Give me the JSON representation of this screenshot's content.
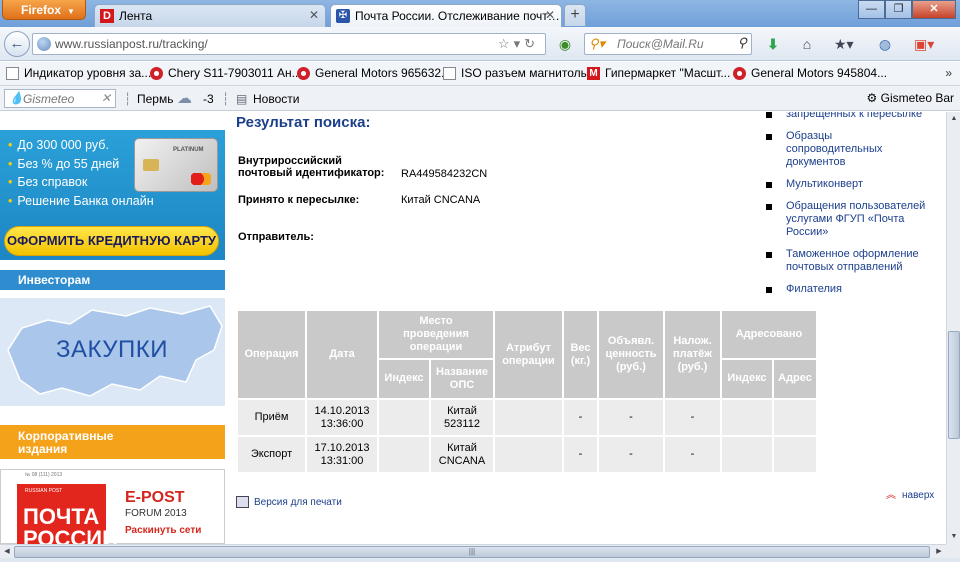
{
  "browser": {
    "menu_button": "Firefox",
    "tabs": [
      {
        "label": "Лента",
        "icon": "d-logo-icon"
      },
      {
        "label": "Почта России. Отслеживание почт…",
        "icon": "russian-post-eagle-icon"
      }
    ],
    "url": "www.russianpost.ru/tracking/",
    "search_placeholder": "Поиск@Mail.Ru"
  },
  "bookmarks": [
    {
      "label": "Индикатор уровня за...",
      "icon": "page-icon"
    },
    {
      "label": "Chery S11-7903011 Ан...",
      "icon": "red-wheel-icon"
    },
    {
      "label": "General Motors 965632...",
      "icon": "red-wheel-icon"
    },
    {
      "label": "ISO разъем магнитолы",
      "icon": "page-icon"
    },
    {
      "label": "Гипермаркет \"Масшт...",
      "icon": "m-logo-icon"
    },
    {
      "label": "General Motors 945804...",
      "icon": "red-wheel-icon"
    }
  ],
  "gismeteo": {
    "input_placeholder": "Gismeteo",
    "city": "Пермь",
    "temperature": "-3",
    "news": "Новости",
    "bar_name": "Gismeteo Bar"
  },
  "sidebar": {
    "credit_items": [
      "До 300 000 руб.",
      "Без % до 55 дней",
      "Без справок",
      "Решение Банка онлайн"
    ],
    "card_text": "PLATINUM",
    "credit_button": "ОФОРМИТЬ КРЕДИТНУЮ КАРТУ",
    "investors": "Инвесторам",
    "zakupki": "ЗАКУПКИ",
    "corporate_line1": "Корпоративные",
    "corporate_line2": "издания",
    "epost_title": "E-POST",
    "epost_subtitle": "FORUM 2013",
    "epost_tagline": "Раскинуть сети",
    "magazine_small": "RUSSIAN POST",
    "magazine_num": "№ 08 (111) 2013",
    "magazine_line1": "ПОЧТА",
    "magazine_line2": "РОССИИ"
  },
  "result": {
    "title": "Результат поиска:",
    "id_label_1": "Внутрироссийский",
    "id_label_2": "почтовый идентификатор:",
    "id_value": "RA449584232CN",
    "accepted_label": "Принято к пересылке:",
    "accepted_value": "Китай CNCANA",
    "sender_label": "Отправитель:"
  },
  "right_links": [
    {
      "line1": "запрещенных к пересылке",
      "line2": "",
      "line3": ""
    },
    {
      "line1": "Образцы",
      "line2": "сопроводительных",
      "line3": "документов"
    },
    {
      "line1": "Мультиконверт",
      "line2": "",
      "line3": ""
    },
    {
      "line1": "Обращения пользователей",
      "line2": "услугами ФГУП «Почта",
      "line3": "России»"
    },
    {
      "line1": "Таможенное оформление",
      "line2": "почтовых отправлений",
      "line3": ""
    },
    {
      "line1": "Филателия",
      "line2": "",
      "line3": ""
    }
  ],
  "table": {
    "headers": {
      "operation": "Операция",
      "date": "Дата",
      "place_1": "Место",
      "place_2": "проведения",
      "place_3": "операции",
      "attr_1": "Атрибут",
      "attr_2": "операции",
      "weight_1": "Вес",
      "weight_2": "(кг.)",
      "value_1": "Объявл.",
      "value_2": "ценность",
      "value_3": "(руб.)",
      "cod_1": "Налож.",
      "cod_2": "платёж",
      "cod_3": "(руб.)",
      "addressed": "Адресовано",
      "index": "Индекс",
      "ops_1": "Название",
      "ops_2": "ОПС",
      "addr_index": "Индекс",
      "addr": "Адрес"
    },
    "rows": [
      {
        "operation": "Приём",
        "date": "14.10.2013",
        "time": "13:36:00",
        "index": "",
        "ops_1": "Китай",
        "ops_2": "523112",
        "attr": "",
        "weight": "-",
        "value": "-",
        "cod": "-",
        "addr_index": "",
        "addr": ""
      },
      {
        "operation": "Экспорт",
        "date": "17.10.2013",
        "time": "13:31:00",
        "index": "",
        "ops_1": "Китай",
        "ops_2": "CNCANA",
        "attr": "",
        "weight": "-",
        "value": "-",
        "cod": "-",
        "addr_index": "",
        "addr": ""
      }
    ]
  },
  "print_link": "Версия для печати",
  "top_link": "наверх"
}
